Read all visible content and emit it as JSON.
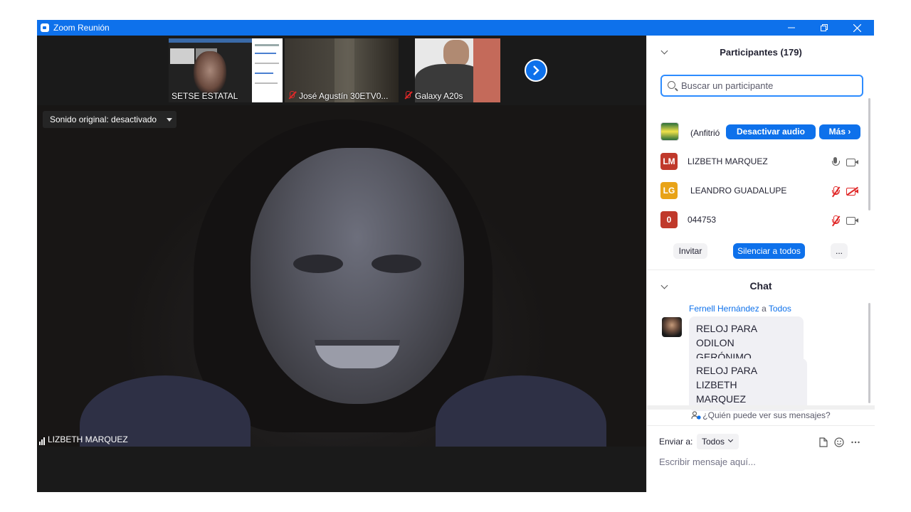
{
  "window": {
    "title": "Zoom Reunión",
    "accent": "#0e71eb"
  },
  "icons": {
    "app": "zoom-icon",
    "minimize": "minimize-icon",
    "maximize": "restore-icon",
    "close": "close-icon",
    "next": "chevron-right-icon",
    "search": "search-icon",
    "mic": "microphone-icon",
    "mic_off": "microphone-muted-icon",
    "cam": "video-camera-icon",
    "cam_off": "video-camera-off-icon",
    "file": "file-icon",
    "emoji": "emoji-icon",
    "more": "more-icon",
    "who": "people-icon"
  },
  "gallery": {
    "thumbs": [
      {
        "label": "SETSE ESTATAL",
        "muted": false
      },
      {
        "label": "José Agustín 30ETV0...",
        "muted": true
      },
      {
        "label": "Galaxy A20s",
        "muted": true
      }
    ]
  },
  "main_video": {
    "sound_option": "Sonido original: desactivado",
    "speaker": "LIZBETH MARQUEZ"
  },
  "participants": {
    "title": "Participantes (179)",
    "search_placeholder": "Buscar un participante",
    "host": {
      "name": "(Anfitrió",
      "mute_button": "Desactivar audio",
      "more_button": "Más ›"
    },
    "list": [
      {
        "initials": "LM",
        "name": "LIZBETH MARQUEZ",
        "color": "#c0392b",
        "audio": "on",
        "video": "off-grey"
      },
      {
        "initials": "LG",
        "name": "LEANDRO GUADALUPE",
        "color": "#e8a317",
        "audio": "muted",
        "video": "muted"
      },
      {
        "initials": "0",
        "name": "044753",
        "color": "#c0392b",
        "audio": "muted",
        "video": "off-grey"
      }
    ],
    "invite_button": "Invitar",
    "mute_all_button": "Silenciar a todos",
    "more_button": "..."
  },
  "chat": {
    "title": "Chat",
    "sender": "Fernell Hernández",
    "to_word": "a",
    "recipient": "Todos",
    "messages": [
      {
        "line1": "RELOJ PARA ODILON",
        "line2": "GERÓNIMO"
      },
      {
        "line1": "RELOJ PARA  LIZBETH",
        "line2": "MARQUEZ"
      }
    ],
    "who_can_see": "¿Quién puede ver sus mensajes?",
    "send_to_label": "Enviar a:",
    "send_to_value": "Todos",
    "input_placeholder": "Escribir mensaje aquí..."
  }
}
